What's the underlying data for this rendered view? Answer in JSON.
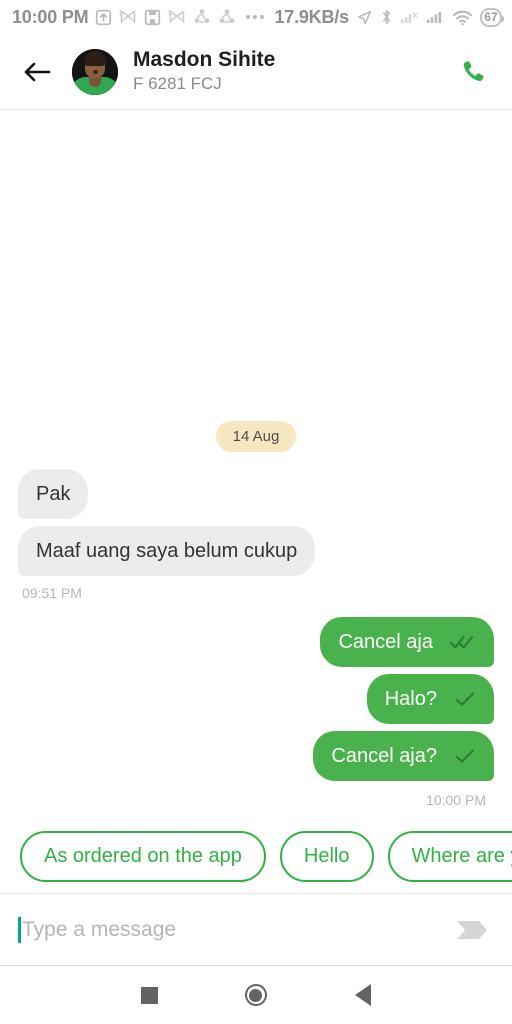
{
  "status_bar": {
    "clock": "10:00 PM",
    "network_speed": "17.9KB/s",
    "battery_level": "67",
    "icons": [
      "upload-arrow-icon",
      "notification-muted-icon",
      "save-icon",
      "notification-muted-icon",
      "sync-icon",
      "sync-icon",
      "overflow-dots-icon",
      "location-arrow-icon",
      "bluetooth-icon",
      "signal-no-service-icon",
      "signal-bars-icon",
      "wifi-icon",
      "battery-icon"
    ]
  },
  "header": {
    "back_icon": "back-arrow-icon",
    "contact_name": "Masdon Sihite",
    "contact_subtitle": "F 6281 FCJ",
    "call_icon": "phone-call-icon",
    "avatar": "contact-avatar"
  },
  "chat": {
    "date_divider": "14 Aug",
    "messages": [
      {
        "text": "Pak",
        "direction": "in"
      },
      {
        "text": "Maaf uang saya belum cukup",
        "direction": "in"
      }
    ],
    "incoming_timestamp": "09:51 PM",
    "outgoing": [
      {
        "text": "Cancel aja",
        "status": "read"
      },
      {
        "text": "Halo?",
        "status": "sent"
      },
      {
        "text": "Cancel aja?",
        "status": "sent"
      }
    ],
    "outgoing_timestamp": "10:00 PM"
  },
  "quick_replies": [
    "As ordered on the app",
    "Hello",
    "Where are yo"
  ],
  "input": {
    "placeholder": "Type a message",
    "value": "",
    "send_icon": "send-arrow-icon"
  },
  "nav_bar": {
    "recents": "recents-square-icon",
    "home": "home-circle-icon",
    "back": "back-triangle-icon"
  },
  "colors": {
    "accent_green": "#49b24d",
    "chip_border": "#2fb342",
    "incoming_bubble": "#ececec",
    "date_badge": "#f6e7c1",
    "caret_teal": "#00a78e"
  }
}
